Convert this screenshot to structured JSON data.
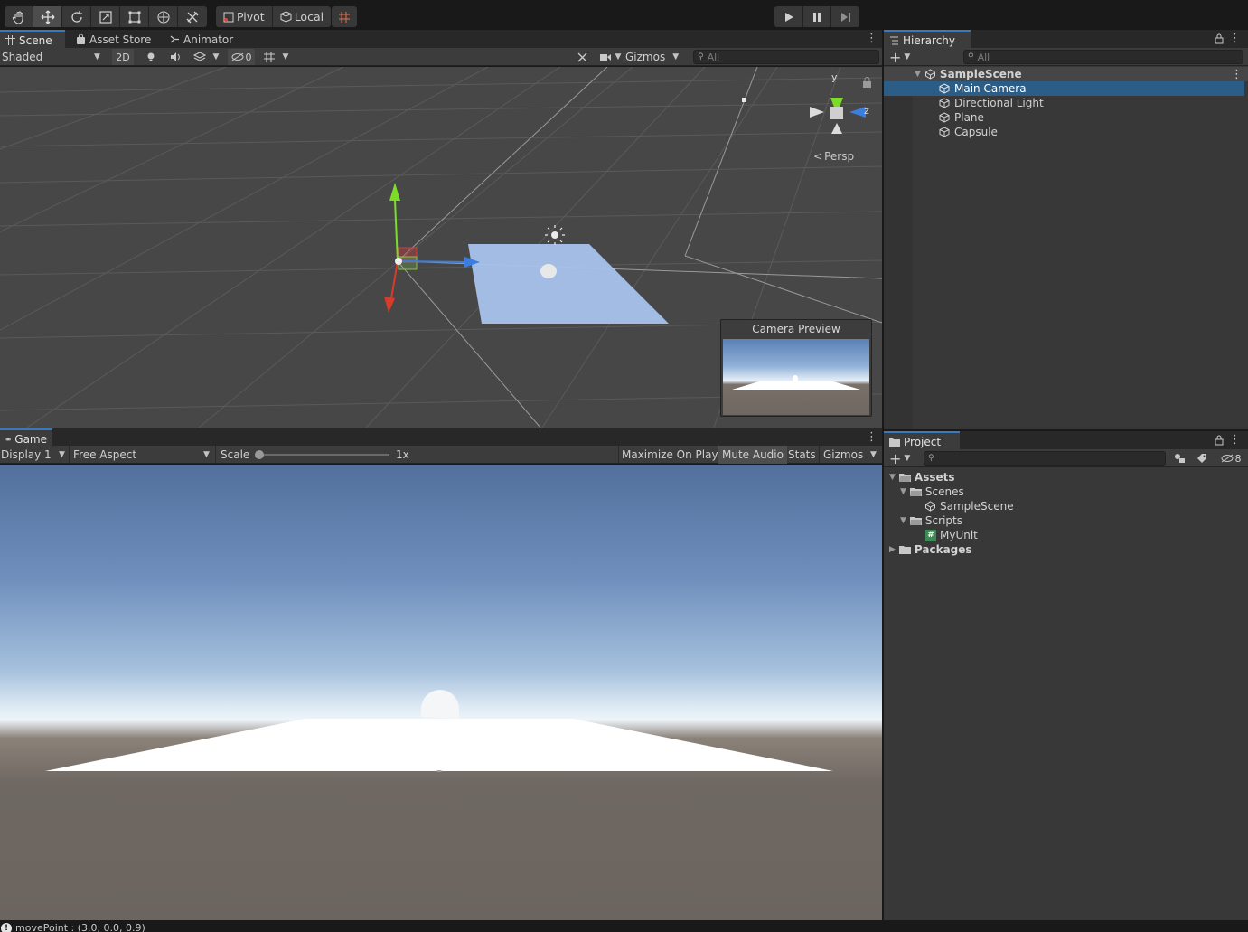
{
  "main_toolbar": {
    "pivot_label": "Pivot",
    "local_label": "Local"
  },
  "scene_window": {
    "tabs": [
      {
        "label": "Scene",
        "icon": "grid-icon"
      },
      {
        "label": "Asset Store",
        "icon": "shopping-bag-icon"
      },
      {
        "label": "Animator",
        "icon": "animator-icon"
      }
    ],
    "draw_mode": "Shaded",
    "mode_2d_label": "2D",
    "hidden_count": "0",
    "gizmos_label": "Gizmos",
    "search_placeholder": "All",
    "axis_y": "y",
    "axis_z": "z",
    "projection_label": "Persp",
    "camera_preview_title": "Camera Preview"
  },
  "game_window": {
    "tab_label": "Game",
    "display": "Display 1",
    "aspect": "Free Aspect",
    "scale_label": "Scale",
    "scale_value": "1x",
    "scale_fraction": 0.0,
    "maximize_label": "Maximize On Play",
    "mute_label": "Mute Audio",
    "stats_label": "Stats",
    "gizmos_label": "Gizmos"
  },
  "hierarchy": {
    "tab_label": "Hierarchy",
    "search_placeholder": "All",
    "scene_name": "SampleScene",
    "items": [
      {
        "label": "Main Camera",
        "selected": true
      },
      {
        "label": "Directional Light",
        "selected": false
      },
      {
        "label": "Plane",
        "selected": false
      },
      {
        "label": "Capsule",
        "selected": false
      }
    ]
  },
  "project": {
    "tab_label": "Project",
    "hidden_count": "8",
    "tree": {
      "assets": "Assets",
      "scenes_folder": "Scenes",
      "scene_file": "SampleScene",
      "scripts_folder": "Scripts",
      "script_file": "MyUnit",
      "packages": "Packages"
    }
  },
  "status_bar": {
    "message": "movePoint : (3.0, 0.0, 0.9)"
  },
  "colors": {
    "selection": "#2c5d87",
    "tab_accent": "#3a79bb",
    "plane_blue": "#a9c3ec",
    "gizmo_y": "#7ddc27",
    "gizmo_x": "#d93b2b",
    "gizmo_z": "#3c7ee0"
  }
}
